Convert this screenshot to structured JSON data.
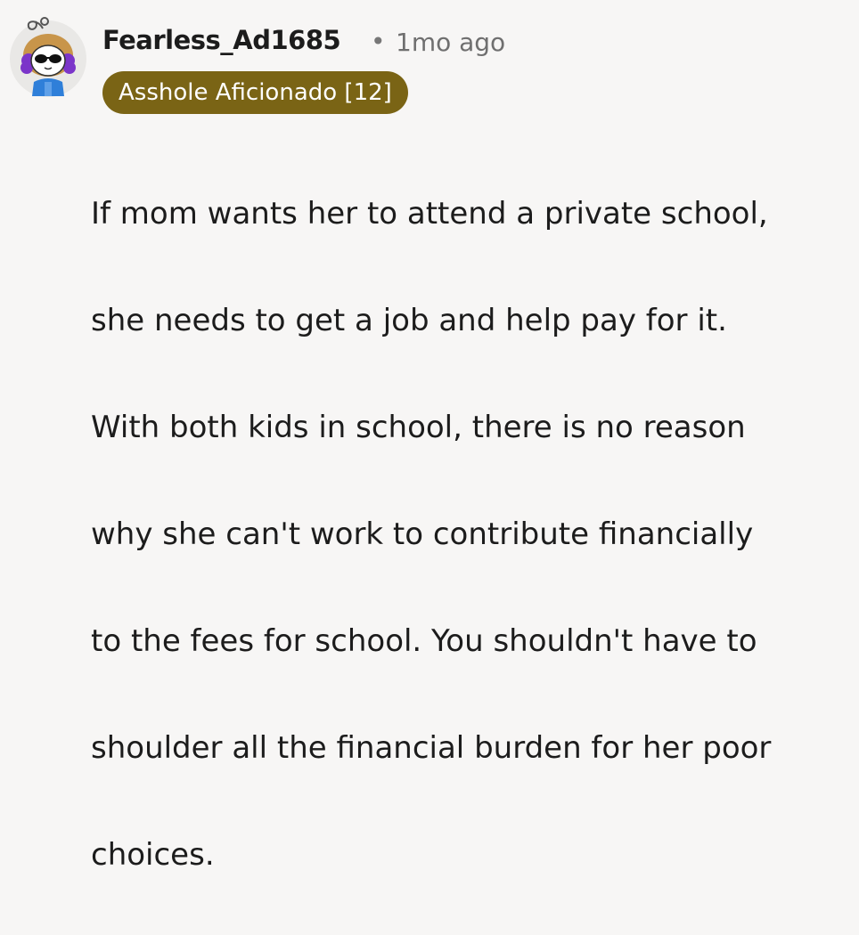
{
  "comment": {
    "author": "Fearless_Ad1685",
    "separator": "•",
    "timestamp": "1mo ago",
    "flair": "Asshole Aficionado [12]",
    "body_lines": [
      "If mom wants her to attend a private school,",
      "she needs to get a job and help pay for it.",
      "With both kids in school, there is no reason",
      "why she can't work to contribute financially",
      "to the fees for school. You shouldn't have to",
      "shoulder all the financial burden for her poor",
      "choices."
    ]
  },
  "colors": {
    "background": "#f7f6f5",
    "flair_background": "#7a6415",
    "flair_text": "#ffffff",
    "timestamp": "#6f6f6f"
  },
  "icons": {
    "avatar": "user-avatar-icon"
  }
}
